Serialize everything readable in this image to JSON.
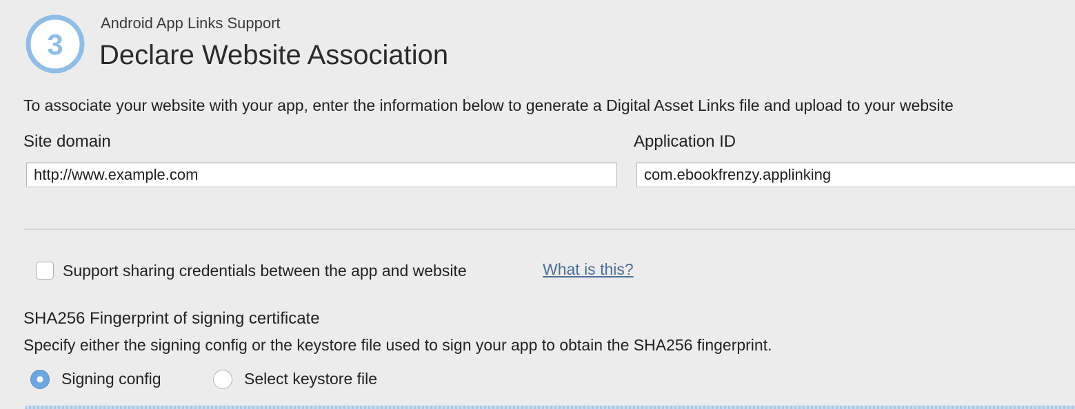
{
  "header": {
    "step_number": "3",
    "subtitle": "Android App Links Support",
    "title": "Declare Website Association"
  },
  "intro_text": "To associate your website with your app, enter the information below to generate a Digital Asset Links file and upload to your website",
  "form": {
    "site_domain": {
      "label": "Site domain",
      "value": "http://www.example.com"
    },
    "application_id": {
      "label": "Application ID",
      "value": "com.ebookfrenzy.applinking"
    }
  },
  "credentials": {
    "checkbox_label": "Support sharing credentials between the app and website",
    "checked": false,
    "help_link": "What is this?"
  },
  "fingerprint": {
    "title": "SHA256 Fingerprint of signing certificate",
    "description": "Specify either the signing config or the keystore file used to sign your app to obtain the SHA256 fingerprint.",
    "options": [
      {
        "label": "Signing config",
        "selected": true
      },
      {
        "label": "Select keystore file",
        "selected": false
      }
    ]
  },
  "colors": {
    "background": "#ececec",
    "accent_blue": "#6ea7df",
    "link": "#4d6f95"
  }
}
